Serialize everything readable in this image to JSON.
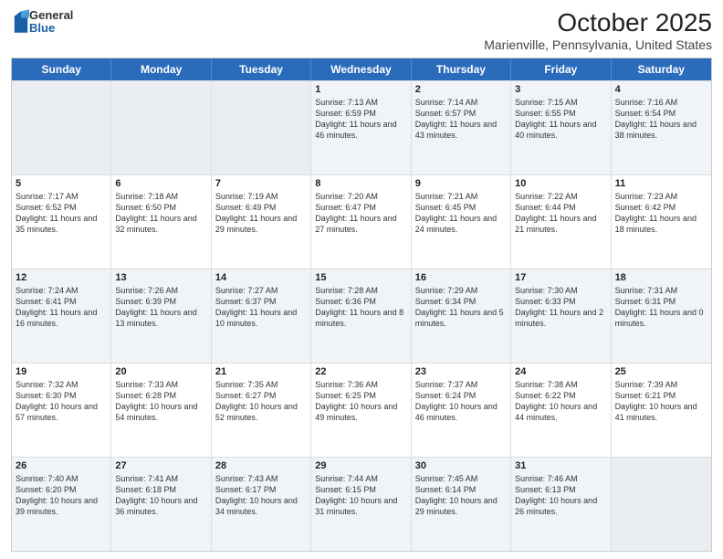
{
  "logo": {
    "general": "General",
    "blue": "Blue"
  },
  "title": "October 2025",
  "subtitle": "Marienville, Pennsylvania, United States",
  "headers": [
    "Sunday",
    "Monday",
    "Tuesday",
    "Wednesday",
    "Thursday",
    "Friday",
    "Saturday"
  ],
  "weeks": [
    [
      {
        "day": "",
        "info": ""
      },
      {
        "day": "",
        "info": ""
      },
      {
        "day": "",
        "info": ""
      },
      {
        "day": "1",
        "info": "Sunrise: 7:13 AM\nSunset: 6:59 PM\nDaylight: 11 hours and 46 minutes."
      },
      {
        "day": "2",
        "info": "Sunrise: 7:14 AM\nSunset: 6:57 PM\nDaylight: 11 hours and 43 minutes."
      },
      {
        "day": "3",
        "info": "Sunrise: 7:15 AM\nSunset: 6:55 PM\nDaylight: 11 hours and 40 minutes."
      },
      {
        "day": "4",
        "info": "Sunrise: 7:16 AM\nSunset: 6:54 PM\nDaylight: 11 hours and 38 minutes."
      }
    ],
    [
      {
        "day": "5",
        "info": "Sunrise: 7:17 AM\nSunset: 6:52 PM\nDaylight: 11 hours and 35 minutes."
      },
      {
        "day": "6",
        "info": "Sunrise: 7:18 AM\nSunset: 6:50 PM\nDaylight: 11 hours and 32 minutes."
      },
      {
        "day": "7",
        "info": "Sunrise: 7:19 AM\nSunset: 6:49 PM\nDaylight: 11 hours and 29 minutes."
      },
      {
        "day": "8",
        "info": "Sunrise: 7:20 AM\nSunset: 6:47 PM\nDaylight: 11 hours and 27 minutes."
      },
      {
        "day": "9",
        "info": "Sunrise: 7:21 AM\nSunset: 6:45 PM\nDaylight: 11 hours and 24 minutes."
      },
      {
        "day": "10",
        "info": "Sunrise: 7:22 AM\nSunset: 6:44 PM\nDaylight: 11 hours and 21 minutes."
      },
      {
        "day": "11",
        "info": "Sunrise: 7:23 AM\nSunset: 6:42 PM\nDaylight: 11 hours and 18 minutes."
      }
    ],
    [
      {
        "day": "12",
        "info": "Sunrise: 7:24 AM\nSunset: 6:41 PM\nDaylight: 11 hours and 16 minutes."
      },
      {
        "day": "13",
        "info": "Sunrise: 7:26 AM\nSunset: 6:39 PM\nDaylight: 11 hours and 13 minutes."
      },
      {
        "day": "14",
        "info": "Sunrise: 7:27 AM\nSunset: 6:37 PM\nDaylight: 11 hours and 10 minutes."
      },
      {
        "day": "15",
        "info": "Sunrise: 7:28 AM\nSunset: 6:36 PM\nDaylight: 11 hours and 8 minutes."
      },
      {
        "day": "16",
        "info": "Sunrise: 7:29 AM\nSunset: 6:34 PM\nDaylight: 11 hours and 5 minutes."
      },
      {
        "day": "17",
        "info": "Sunrise: 7:30 AM\nSunset: 6:33 PM\nDaylight: 11 hours and 2 minutes."
      },
      {
        "day": "18",
        "info": "Sunrise: 7:31 AM\nSunset: 6:31 PM\nDaylight: 11 hours and 0 minutes."
      }
    ],
    [
      {
        "day": "19",
        "info": "Sunrise: 7:32 AM\nSunset: 6:30 PM\nDaylight: 10 hours and 57 minutes."
      },
      {
        "day": "20",
        "info": "Sunrise: 7:33 AM\nSunset: 6:28 PM\nDaylight: 10 hours and 54 minutes."
      },
      {
        "day": "21",
        "info": "Sunrise: 7:35 AM\nSunset: 6:27 PM\nDaylight: 10 hours and 52 minutes."
      },
      {
        "day": "22",
        "info": "Sunrise: 7:36 AM\nSunset: 6:25 PM\nDaylight: 10 hours and 49 minutes."
      },
      {
        "day": "23",
        "info": "Sunrise: 7:37 AM\nSunset: 6:24 PM\nDaylight: 10 hours and 46 minutes."
      },
      {
        "day": "24",
        "info": "Sunrise: 7:38 AM\nSunset: 6:22 PM\nDaylight: 10 hours and 44 minutes."
      },
      {
        "day": "25",
        "info": "Sunrise: 7:39 AM\nSunset: 6:21 PM\nDaylight: 10 hours and 41 minutes."
      }
    ],
    [
      {
        "day": "26",
        "info": "Sunrise: 7:40 AM\nSunset: 6:20 PM\nDaylight: 10 hours and 39 minutes."
      },
      {
        "day": "27",
        "info": "Sunrise: 7:41 AM\nSunset: 6:18 PM\nDaylight: 10 hours and 36 minutes."
      },
      {
        "day": "28",
        "info": "Sunrise: 7:43 AM\nSunset: 6:17 PM\nDaylight: 10 hours and 34 minutes."
      },
      {
        "day": "29",
        "info": "Sunrise: 7:44 AM\nSunset: 6:15 PM\nDaylight: 10 hours and 31 minutes."
      },
      {
        "day": "30",
        "info": "Sunrise: 7:45 AM\nSunset: 6:14 PM\nDaylight: 10 hours and 29 minutes."
      },
      {
        "day": "31",
        "info": "Sunrise: 7:46 AM\nSunset: 6:13 PM\nDaylight: 10 hours and 26 minutes."
      },
      {
        "day": "",
        "info": ""
      }
    ]
  ],
  "alt_weeks": [
    0,
    2,
    4
  ]
}
